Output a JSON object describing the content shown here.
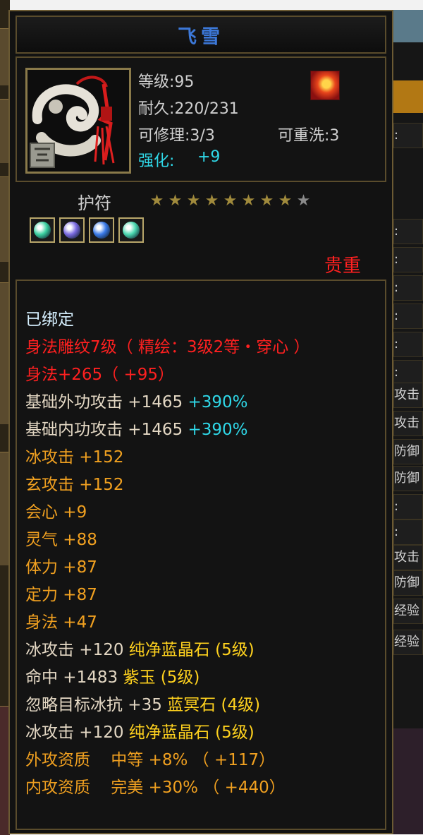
{
  "item": {
    "name": "飞雪",
    "level_text": "等级:95",
    "durability_text": "耐久:220/231",
    "repair_text": "可修理:3/3",
    "rewash_text": "可重洗:3",
    "enhance_label": "强化:",
    "enhance_value": "+9",
    "category": "护符",
    "star_rating": {
      "filled": 8,
      "total": 9
    },
    "rarity": "贵重",
    "gem_sockets": [
      {
        "icon": "green-crystal-gem-icon",
        "color": "#3ad0a0"
      },
      {
        "icon": "purple-crystal-gem-icon",
        "color": "#7a6ae0"
      },
      {
        "icon": "blue-crystal-gem-icon",
        "color": "#3a7ae8"
      },
      {
        "icon": "green-crystal-gem-icon",
        "color": "#4ad8b0"
      }
    ]
  },
  "attributes": {
    "bound": "已绑定",
    "engrave": "身法雕纹7级（ 精绘：3级2等・穿心 ）",
    "agility_bonus": "身法+265（ +95）",
    "base_ext_atk": "基础外功攻击 +1465",
    "base_ext_atk_pct": "+390%",
    "base_int_atk": "基础内功攻击 +1465",
    "base_int_atk_pct": "+390%",
    "ice_atk": "冰攻击 +152",
    "mystic_atk": "玄攻击 +152",
    "crit": "会心 +9",
    "spirit": "灵气 +88",
    "stamina": "体力 +87",
    "focus": "定力 +87",
    "agility": "身法 +47"
  },
  "gems": [
    {
      "stat": "冰攻击 +120",
      "gem": "纯净蓝晶石 (5级)"
    },
    {
      "stat": "命中 +1483",
      "gem": "紫玉 (5级)"
    },
    {
      "stat": "忽略目标冰抗 +35",
      "gem": "蓝冥石 (4级)"
    },
    {
      "stat": "冰攻击 +120",
      "gem": "纯净蓝晶石 (5级)"
    }
  ],
  "aptitudes": [
    {
      "label": "外攻资质",
      "grade": "中等",
      "value": "+8%",
      "bonus": "（ +117）"
    },
    {
      "label": "内攻资质",
      "grade": "完美",
      "value": "+30%",
      "bonus": "（ +440）"
    }
  ],
  "background": {
    "right_fragments": [
      "",
      "",
      ":",
      ":",
      ":",
      ":",
      ":",
      ":",
      ":",
      "攻击",
      "攻击",
      "防御",
      "防御",
      ":",
      ":",
      "攻击",
      "防御",
      "经验",
      "经验"
    ]
  },
  "colors": {
    "title": "#3c78d8",
    "rarity": "#ff2020",
    "enhance": "#2fd8e8",
    "engrave": "#ff2020",
    "gem_line": "#ffd21e",
    "aptitude": "#f0a020"
  }
}
